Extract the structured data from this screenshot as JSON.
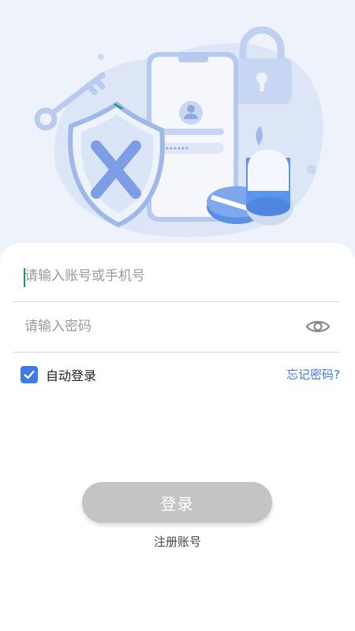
{
  "login_form": {
    "account_placeholder": "请输入账号或手机号",
    "password_placeholder": "请输入密码",
    "auto_login_label": "自动登录",
    "auto_login_checked": true,
    "forgot_password_label": "忘记密码?",
    "login_button_label": "登录",
    "register_label": "注册账号"
  },
  "icons": {
    "password_toggle": "eye-icon",
    "checkbox": "checkmark-icon"
  },
  "colors": {
    "accent": "#3f7ae8",
    "link": "#3c7ae0",
    "button_disabled": "#c4c4c4",
    "background": "#eef2fb"
  }
}
